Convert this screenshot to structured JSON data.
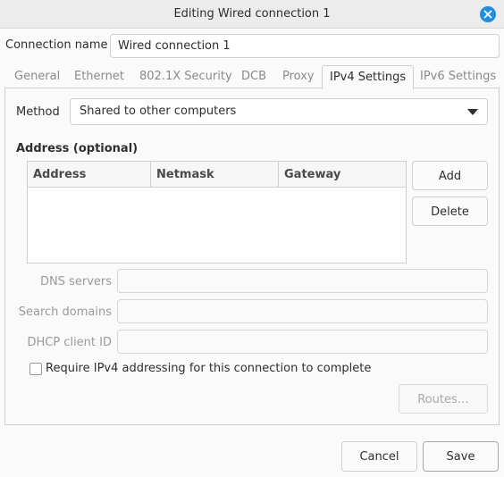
{
  "window": {
    "title": "Editing Wired connection 1"
  },
  "connection": {
    "label": "Connection name",
    "value": "Wired connection 1"
  },
  "tabs": [
    {
      "label": "General",
      "active": false
    },
    {
      "label": "Ethernet",
      "active": false
    },
    {
      "label": "802.1X Security",
      "active": false
    },
    {
      "label": "DCB",
      "active": false
    },
    {
      "label": "Proxy",
      "active": false
    },
    {
      "label": "IPv4 Settings",
      "active": true
    },
    {
      "label": "IPv6 Settings",
      "active": false
    }
  ],
  "ipv4": {
    "method_label": "Method",
    "method_value": "Shared to other computers",
    "address_title": "Address (optional)",
    "columns": [
      "Address",
      "Netmask",
      "Gateway"
    ],
    "rows": [],
    "add_label": "Add",
    "delete_label": "Delete",
    "dns_label": "DNS servers",
    "dns_value": "",
    "search_label": "Search domains",
    "search_value": "",
    "dhcp_label": "DHCP client ID",
    "dhcp_value": "",
    "require_label": "Require IPv4 addressing for this connection to complete",
    "require_checked": false,
    "routes_label": "Routes…"
  },
  "footer": {
    "cancel_label": "Cancel",
    "save_label": "Save"
  },
  "colors": {
    "accent": "#1f8de0"
  }
}
